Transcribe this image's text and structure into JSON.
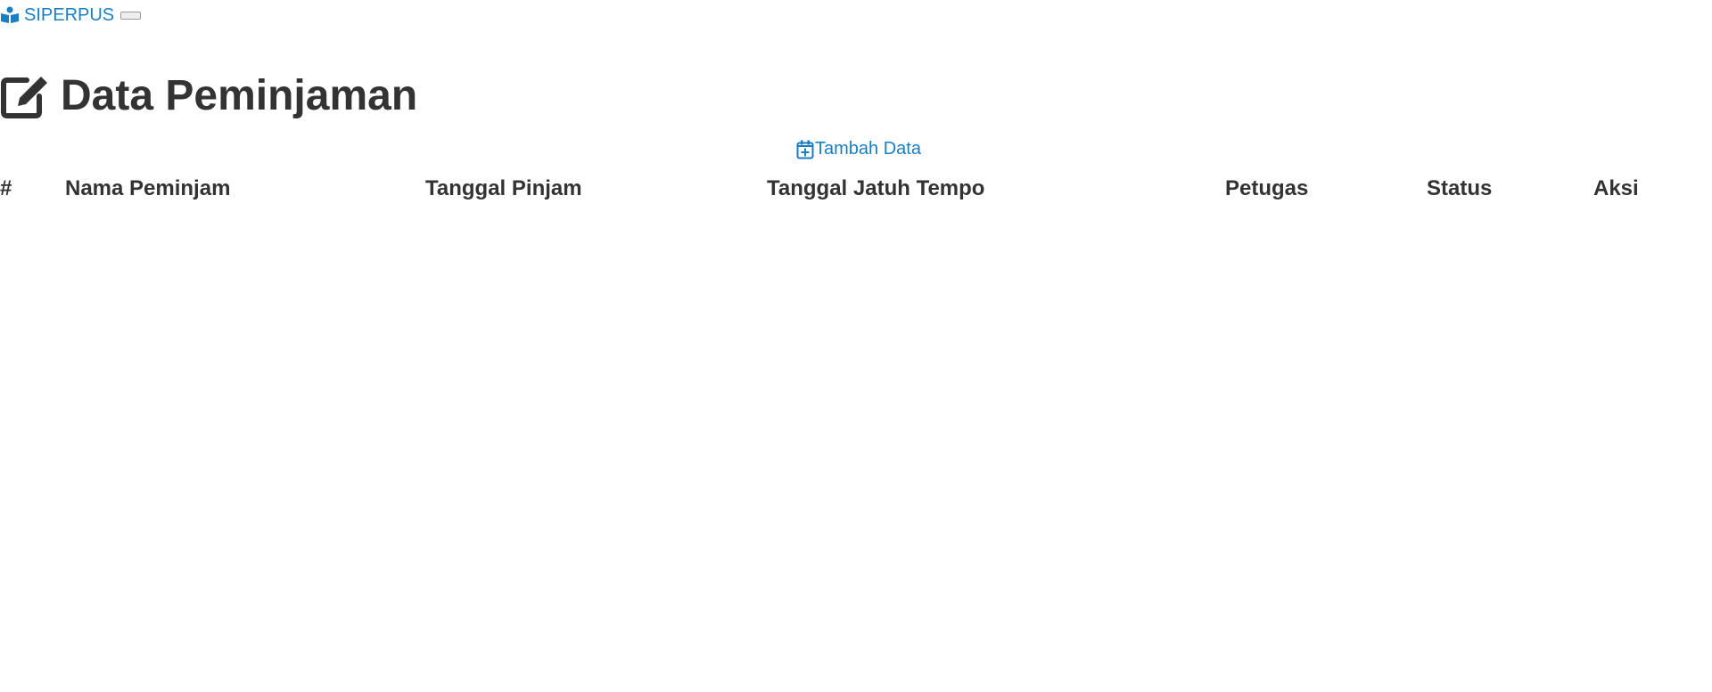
{
  "navbar": {
    "brand_label": "SIPERPUS",
    "brand_icon": "book-reader-icon",
    "brand_color": "#1a7fc1",
    "toggler_icon": "menu-toggler"
  },
  "page": {
    "title": "Data Peminjaman",
    "title_icon": "edit-icon"
  },
  "actions": {
    "add_label": "Tambah Data",
    "add_icon": "calendar-plus-icon"
  },
  "table": {
    "headers": [
      "#",
      "Nama Peminjam",
      "Tanggal Pinjam",
      "Tanggal Jatuh Tempo",
      "Petugas",
      "Status",
      "Aksi"
    ],
    "rows": []
  }
}
